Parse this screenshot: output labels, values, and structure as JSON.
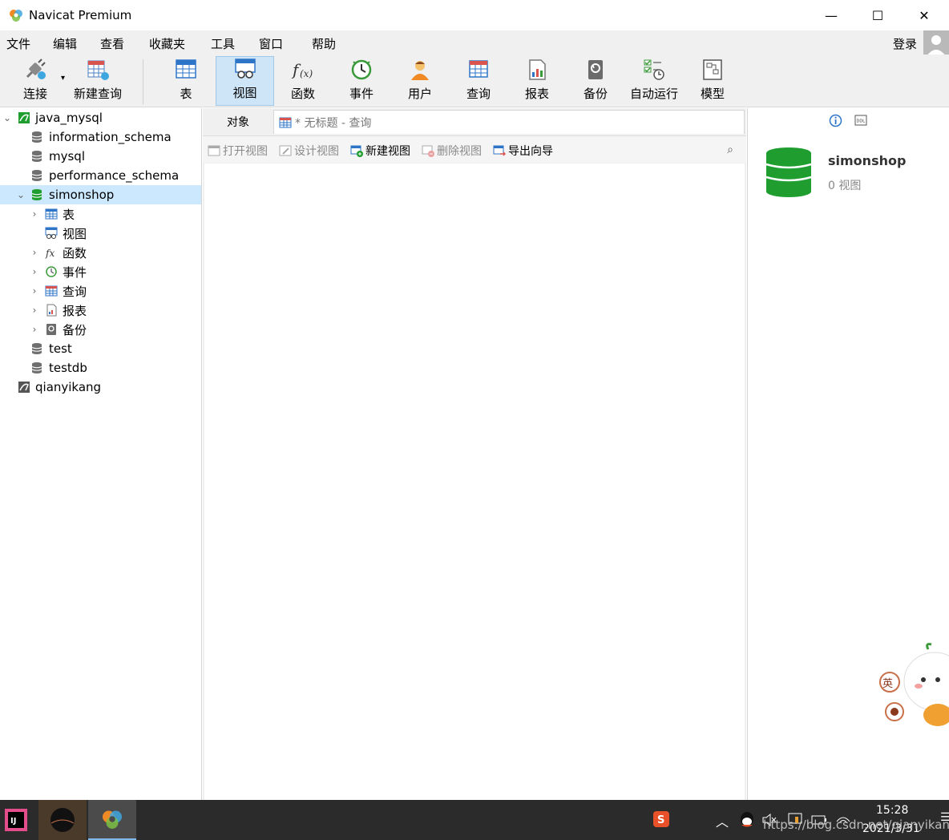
{
  "window": {
    "title": "Navicat Premium",
    "minimize_glyph": "—",
    "maximize_glyph": "☐",
    "close_glyph": "✕"
  },
  "menu": {
    "items": [
      "文件",
      "编辑",
      "查看",
      "收藏夹",
      "工具",
      "窗口",
      "帮助"
    ],
    "login": "登录"
  },
  "toolbar": {
    "buttons": [
      {
        "label": "连接",
        "icon": "connection-icon"
      },
      {
        "label": "新建查询",
        "icon": "new-query-icon"
      },
      {
        "label": "表",
        "icon": "table-icon"
      },
      {
        "label": "视图",
        "icon": "view-icon",
        "active": true
      },
      {
        "label": "函数",
        "icon": "function-icon"
      },
      {
        "label": "事件",
        "icon": "event-icon"
      },
      {
        "label": "用户",
        "icon": "user-icon"
      },
      {
        "label": "查询",
        "icon": "query-icon"
      },
      {
        "label": "报表",
        "icon": "report-icon"
      },
      {
        "label": "备份",
        "icon": "backup-icon"
      },
      {
        "label": "自动运行",
        "icon": "automation-icon"
      },
      {
        "label": "模型",
        "icon": "model-icon"
      }
    ]
  },
  "tree": {
    "connection1": "java_mysql",
    "databases": [
      "information_schema",
      "mysql",
      "performance_schema"
    ],
    "selected_db": "simonshop",
    "children": [
      "表",
      "视图",
      "函数",
      "事件",
      "查询",
      "报表",
      "备份"
    ],
    "more_dbs": [
      "test",
      "testdb"
    ],
    "connection2": "qianyikang"
  },
  "tabs": {
    "objects": "对象",
    "query": "* 无标题 - 查询"
  },
  "object_toolbar": {
    "open_view": "打开视图",
    "design_view": "设计视图",
    "new_view": "新建视图",
    "delete_view": "删除视图",
    "export_wizard": "导出向导",
    "search_glyph": "⌕"
  },
  "info_panel": {
    "db_name": "simonshop",
    "count_text": "0 视图"
  },
  "taskbar": {
    "time": "15:28",
    "date": "2021/3/31",
    "ime": "英",
    "watermark": "https://blog.csdn.net/qianyikang"
  },
  "colors": {
    "db_green": "#1f9e2f",
    "active_tab": "#cde5f7",
    "selection": "#cce8ff",
    "taskbar": "#2b2b2b"
  }
}
